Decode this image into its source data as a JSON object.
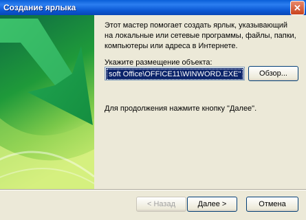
{
  "window": {
    "title": "Создание ярлыка",
    "close_glyph": "✕"
  },
  "wizard": {
    "intro_text": "Этот мастер помогает создать ярлык, указывающий\nна локальные или сетевые программы, файлы, папки,\nкомпьютеры или адреса в Интернете.",
    "location_label": "Укажите размещение объекта:",
    "location_value": "soft Office\\OFFICE11\\WINWORD.EXE\"",
    "browse_button": "Обзор...",
    "continue_hint": "Для продолжения нажмите кнопку \"Далее\"."
  },
  "footer": {
    "back_button": "< Назад",
    "next_button": "Далее >",
    "cancel_button": "Отмена"
  },
  "icons": {
    "close": "close-icon",
    "wizard_art": "green-arrow-graphic"
  },
  "colors": {
    "title_bar": "#0a5fd8",
    "selection": "#0b246a",
    "dialog_bg": "#ece9d8"
  }
}
